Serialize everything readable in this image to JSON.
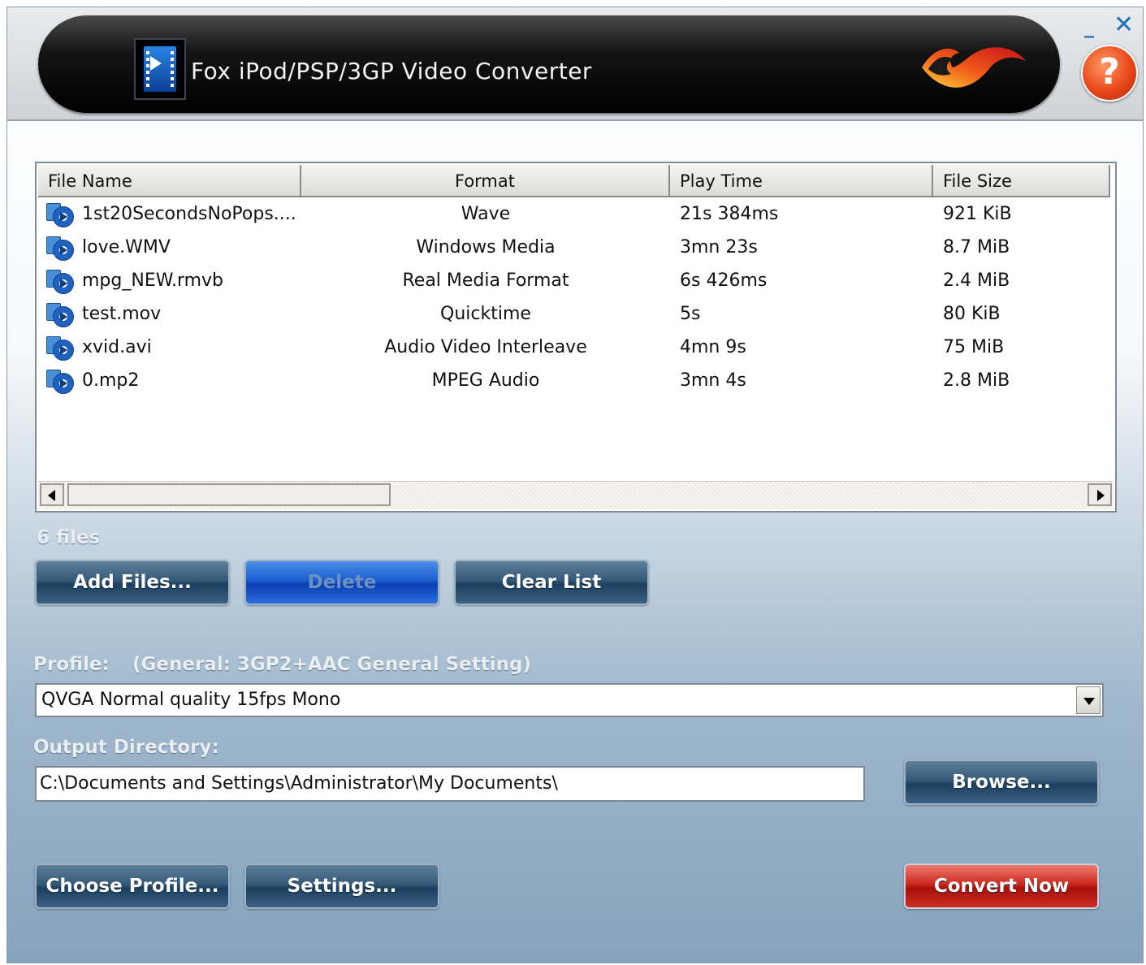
{
  "app": {
    "title": "Fox iPod/PSP/3GP Video Converter"
  },
  "window_controls": {
    "minimize": "_",
    "close": "✕",
    "help": "?"
  },
  "file_list": {
    "columns": [
      "File Name",
      "Format",
      "Play Time",
      "File Size"
    ],
    "rows": [
      {
        "name": "1st20SecondsNoPops....",
        "format": "Wave",
        "play_time": "21s 384ms",
        "size": "921 KiB"
      },
      {
        "name": "love.WMV",
        "format": "Windows Media",
        "play_time": "3mn 23s",
        "size": "8.7 MiB"
      },
      {
        "name": "mpg_NEW.rmvb",
        "format": "Real Media Format",
        "play_time": "6s 426ms",
        "size": "2.4 MiB"
      },
      {
        "name": "test.mov",
        "format": "Quicktime",
        "play_time": "5s",
        "size": "80 KiB"
      },
      {
        "name": "xvid.avi",
        "format": "Audio Video Interleave",
        "play_time": "4mn 9s",
        "size": "75 MiB"
      },
      {
        "name": "0.mp2",
        "format": "MPEG Audio",
        "play_time": "3mn 4s",
        "size": "2.8 MiB"
      }
    ],
    "count_label": "6 files"
  },
  "list_buttons": {
    "add": "Add Files...",
    "delete": "Delete",
    "clear": "Clear List"
  },
  "profile": {
    "label": "Profile:",
    "category": "(General: 3GP2+AAC General Setting)",
    "selected": "QVGA Normal quality 15fps Mono"
  },
  "output": {
    "label": "Output Directory:",
    "path": "C:\\Documents and Settings\\Administrator\\My Documents\\",
    "browse": "Browse..."
  },
  "bottom_buttons": {
    "choose_profile": "Choose Profile...",
    "settings": "Settings...",
    "convert": "Convert Now"
  },
  "colors": {
    "accent_blue": "#1f6fb7",
    "convert_red": "#cc2a1e",
    "title_bar": "#000000"
  }
}
